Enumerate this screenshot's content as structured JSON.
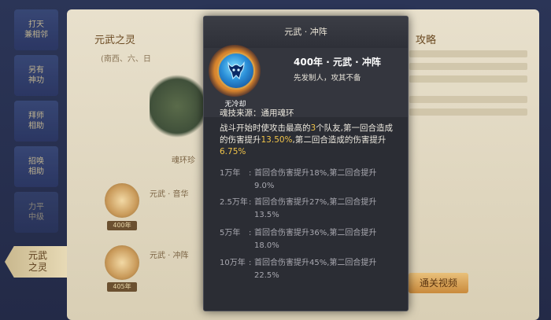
{
  "background": {
    "left_tabs": [
      "打天\n兼相邻",
      "另有\n神功",
      "拜师\n相助",
      "招唤\n相助",
      "力平\n中级"
    ],
    "active_tab": "元武\n之灵",
    "left_title": "元武之灵",
    "left_sub": "(南西、六、日",
    "right_title": "攻略",
    "soul_label": "魂环珍",
    "item1_label": "元武 · 音华",
    "item1_tag": "400年",
    "item2_label": "元武 · 冲阵",
    "item2_tag": "405年",
    "button_label": "通关视频"
  },
  "dialog": {
    "title": "元武 · 冲阵",
    "skill_name": "400年 · 元武 · 冲阵",
    "skill_desc": "先发制人，攻其不备",
    "icon_caption": "无冷却",
    "source": "魂技来源：通用魂环",
    "effect_parts": [
      "战斗开始时使攻击最高的",
      "3",
      "个队友,第一回合造成的伤害提升",
      "13.50%",
      ",第二回合造成的伤害提升",
      "6.75%"
    ],
    "upgrades": [
      {
        "year": "1万年",
        "text": "首回合伤害提升18%,第二回合提升9.0%"
      },
      {
        "year": "2.5万年",
        "text": "首回合伤害提升27%,第二回合提升13.5%"
      },
      {
        "year": "5万年",
        "text": "首回合伤害提升36%,第二回合提升18.0%"
      },
      {
        "year": "10万年",
        "text": "首回合伤害提升45%,第二回合提升22.5%"
      }
    ]
  },
  "colors": {
    "highlight": "#f1c44a",
    "dialog_bg": "#2b2d34"
  }
}
